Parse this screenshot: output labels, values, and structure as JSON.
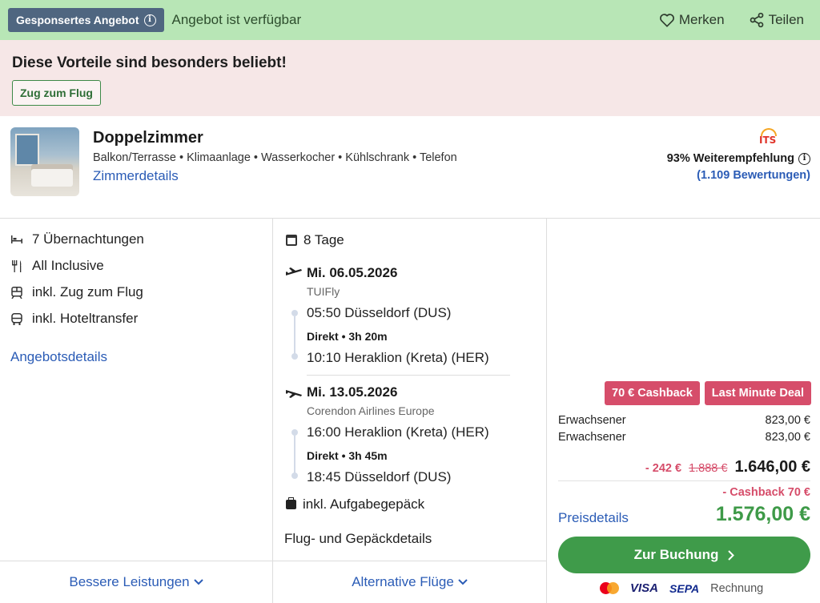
{
  "topbar": {
    "sponsored_label": "Gesponsertes Angebot",
    "availability": "Angebot ist verfügbar",
    "save_label": "Merken",
    "share_label": "Teilen",
    "bg_color": "#b8e6b6"
  },
  "promo": {
    "title": "Diese Vorteile sind besonders beliebt!",
    "pill": "Zug zum Flug"
  },
  "room": {
    "title": "Doppelzimmer",
    "features": "Balkon/Terrasse • Klimaanlage • Wasserkocher • Kühlschrank • Telefon",
    "details_link": "Zimmerdetails",
    "rating_logo": "ITS",
    "recommendation": "93% Weiterempfehlung",
    "reviews": "(1.109 Bewertungen)"
  },
  "inclusions": {
    "items": [
      {
        "icon": "bed-icon",
        "label": "7 Übernachtungen"
      },
      {
        "icon": "cutlery-icon",
        "label": "All Inclusive"
      },
      {
        "icon": "train-icon",
        "label": "inkl. Zug zum Flug"
      },
      {
        "icon": "bus-icon",
        "label": "inkl. Hoteltransfer"
      }
    ],
    "details_link": "Angebotsdetails"
  },
  "flights": {
    "duration": "8 Tage",
    "outbound": {
      "date": "Mi. 06.05.2026",
      "airline": "TUIFly",
      "dep": "05:50 Düsseldorf (DUS)",
      "info": "Direkt • 3h 20m",
      "arr": "10:10 Heraklion (Kreta) (HER)"
    },
    "return": {
      "date": "Mi. 13.05.2026",
      "airline": "Corendon Airlines Europe",
      "dep": "16:00 Heraklion (Kreta) (HER)",
      "info": "Direkt • 3h 45m",
      "arr": "18:45 Düsseldorf (DUS)"
    },
    "baggage": "inkl. Aufgabegepäck",
    "details_link": "Flug- und Gepäckdetails"
  },
  "tabs": {
    "better": "Bessere Leistungen",
    "alt_flights": "Alternative Flüge"
  },
  "price": {
    "badges": [
      "70 € Cashback",
      "Last Minute Deal"
    ],
    "rows": [
      {
        "label": "Erwachsener",
        "value": "823,00 €"
      },
      {
        "label": "Erwachsener",
        "value": "823,00 €"
      }
    ],
    "discount": "- 242 €",
    "old_price": "1.888 €",
    "total": "1.646,00 €",
    "cashback": "- Cashback 70 €",
    "details_link": "Preisdetails",
    "final": "1.576,00 €",
    "book_button": "Zur Buchung",
    "payments": {
      "visa": "VISA",
      "sepa": "SEPA",
      "invoice": "Rechnung"
    },
    "accent": "#3f9b4a",
    "badge_color": "#d64d6a"
  }
}
